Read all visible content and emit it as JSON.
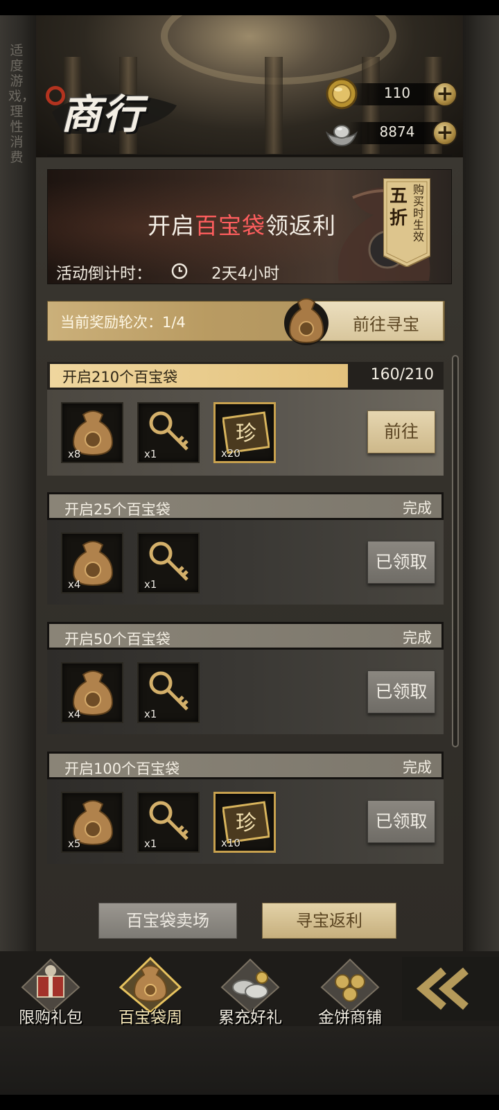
{
  "side_note": "适度游戏，理性消费",
  "header": {
    "title": "商行",
    "currencies": [
      {
        "name": "gold-coin",
        "value": "110"
      },
      {
        "name": "silver-ingot",
        "value": "8874"
      }
    ]
  },
  "banner": {
    "title_prefix": "开启",
    "title_highlight": "百宝袋",
    "title_suffix": "领返利",
    "countdown_label": "活动倒计时：",
    "countdown_value": "2天4小时",
    "tag_big": "五折",
    "tag_small": "购买时生效"
  },
  "round": {
    "label": "当前奖励轮次：1/4",
    "button": "前往寻宝"
  },
  "tasks": [
    {
      "label": "开启210个百宝袋",
      "progress": "160/210",
      "progress_fraction": 0.762,
      "items": [
        {
          "icon": "treasure-bag-icon",
          "qty": "x8"
        },
        {
          "icon": "key-icon",
          "qty": "x1"
        },
        {
          "icon": "rare-ticket-icon",
          "qty": "x20"
        }
      ],
      "button": "前往"
    },
    {
      "label": "开启25个百宝袋",
      "status": "完成",
      "items": [
        {
          "icon": "treasure-bag-icon",
          "qty": "x4"
        },
        {
          "icon": "key-icon",
          "qty": "x1"
        }
      ],
      "button": "已领取"
    },
    {
      "label": "开启50个百宝袋",
      "status": "完成",
      "items": [
        {
          "icon": "treasure-bag-icon",
          "qty": "x4"
        },
        {
          "icon": "key-icon",
          "qty": "x1"
        }
      ],
      "button": "已领取"
    },
    {
      "label": "开启100个百宝袋",
      "status": "完成",
      "items": [
        {
          "icon": "treasure-bag-icon",
          "qty": "x5"
        },
        {
          "icon": "key-icon",
          "qty": "x1"
        },
        {
          "icon": "rare-ticket-icon",
          "qty": "x10"
        }
      ],
      "button": "已领取"
    }
  ],
  "ticket_glyph": "珍",
  "bottom_tabs": {
    "left": "百宝袋卖场",
    "right": "寻宝返利"
  },
  "nav": [
    {
      "label": "限购礼包",
      "icon": "gift-pack-icon"
    },
    {
      "label": "百宝袋周",
      "icon": "treasure-bag-week-icon"
    },
    {
      "label": "累充好礼",
      "icon": "recharge-gift-icon"
    },
    {
      "label": "金饼商铺",
      "icon": "gold-cake-shop-icon"
    }
  ],
  "colors": {
    "highlight_red": "#ff5e5e",
    "gold_accent": "#c8a14e"
  }
}
